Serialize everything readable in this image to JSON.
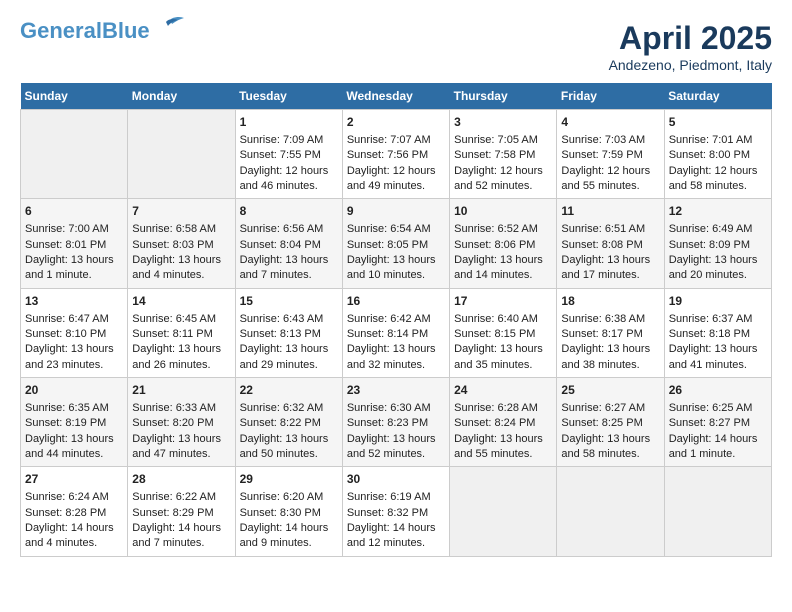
{
  "header": {
    "logo_general": "General",
    "logo_blue": "Blue",
    "month": "April 2025",
    "location": "Andezeno, Piedmont, Italy"
  },
  "weekdays": [
    "Sunday",
    "Monday",
    "Tuesday",
    "Wednesday",
    "Thursday",
    "Friday",
    "Saturday"
  ],
  "weeks": [
    [
      {
        "day": "",
        "empty": true
      },
      {
        "day": "",
        "empty": true
      },
      {
        "day": "1",
        "sunrise": "Sunrise: 7:09 AM",
        "sunset": "Sunset: 7:55 PM",
        "daylight": "Daylight: 12 hours and 46 minutes."
      },
      {
        "day": "2",
        "sunrise": "Sunrise: 7:07 AM",
        "sunset": "Sunset: 7:56 PM",
        "daylight": "Daylight: 12 hours and 49 minutes."
      },
      {
        "day": "3",
        "sunrise": "Sunrise: 7:05 AM",
        "sunset": "Sunset: 7:58 PM",
        "daylight": "Daylight: 12 hours and 52 minutes."
      },
      {
        "day": "4",
        "sunrise": "Sunrise: 7:03 AM",
        "sunset": "Sunset: 7:59 PM",
        "daylight": "Daylight: 12 hours and 55 minutes."
      },
      {
        "day": "5",
        "sunrise": "Sunrise: 7:01 AM",
        "sunset": "Sunset: 8:00 PM",
        "daylight": "Daylight: 12 hours and 58 minutes."
      }
    ],
    [
      {
        "day": "6",
        "sunrise": "Sunrise: 7:00 AM",
        "sunset": "Sunset: 8:01 PM",
        "daylight": "Daylight: 13 hours and 1 minute."
      },
      {
        "day": "7",
        "sunrise": "Sunrise: 6:58 AM",
        "sunset": "Sunset: 8:03 PM",
        "daylight": "Daylight: 13 hours and 4 minutes."
      },
      {
        "day": "8",
        "sunrise": "Sunrise: 6:56 AM",
        "sunset": "Sunset: 8:04 PM",
        "daylight": "Daylight: 13 hours and 7 minutes."
      },
      {
        "day": "9",
        "sunrise": "Sunrise: 6:54 AM",
        "sunset": "Sunset: 8:05 PM",
        "daylight": "Daylight: 13 hours and 10 minutes."
      },
      {
        "day": "10",
        "sunrise": "Sunrise: 6:52 AM",
        "sunset": "Sunset: 8:06 PM",
        "daylight": "Daylight: 13 hours and 14 minutes."
      },
      {
        "day": "11",
        "sunrise": "Sunrise: 6:51 AM",
        "sunset": "Sunset: 8:08 PM",
        "daylight": "Daylight: 13 hours and 17 minutes."
      },
      {
        "day": "12",
        "sunrise": "Sunrise: 6:49 AM",
        "sunset": "Sunset: 8:09 PM",
        "daylight": "Daylight: 13 hours and 20 minutes."
      }
    ],
    [
      {
        "day": "13",
        "sunrise": "Sunrise: 6:47 AM",
        "sunset": "Sunset: 8:10 PM",
        "daylight": "Daylight: 13 hours and 23 minutes."
      },
      {
        "day": "14",
        "sunrise": "Sunrise: 6:45 AM",
        "sunset": "Sunset: 8:11 PM",
        "daylight": "Daylight: 13 hours and 26 minutes."
      },
      {
        "day": "15",
        "sunrise": "Sunrise: 6:43 AM",
        "sunset": "Sunset: 8:13 PM",
        "daylight": "Daylight: 13 hours and 29 minutes."
      },
      {
        "day": "16",
        "sunrise": "Sunrise: 6:42 AM",
        "sunset": "Sunset: 8:14 PM",
        "daylight": "Daylight: 13 hours and 32 minutes."
      },
      {
        "day": "17",
        "sunrise": "Sunrise: 6:40 AM",
        "sunset": "Sunset: 8:15 PM",
        "daylight": "Daylight: 13 hours and 35 minutes."
      },
      {
        "day": "18",
        "sunrise": "Sunrise: 6:38 AM",
        "sunset": "Sunset: 8:17 PM",
        "daylight": "Daylight: 13 hours and 38 minutes."
      },
      {
        "day": "19",
        "sunrise": "Sunrise: 6:37 AM",
        "sunset": "Sunset: 8:18 PM",
        "daylight": "Daylight: 13 hours and 41 minutes."
      }
    ],
    [
      {
        "day": "20",
        "sunrise": "Sunrise: 6:35 AM",
        "sunset": "Sunset: 8:19 PM",
        "daylight": "Daylight: 13 hours and 44 minutes."
      },
      {
        "day": "21",
        "sunrise": "Sunrise: 6:33 AM",
        "sunset": "Sunset: 8:20 PM",
        "daylight": "Daylight: 13 hours and 47 minutes."
      },
      {
        "day": "22",
        "sunrise": "Sunrise: 6:32 AM",
        "sunset": "Sunset: 8:22 PM",
        "daylight": "Daylight: 13 hours and 50 minutes."
      },
      {
        "day": "23",
        "sunrise": "Sunrise: 6:30 AM",
        "sunset": "Sunset: 8:23 PM",
        "daylight": "Daylight: 13 hours and 52 minutes."
      },
      {
        "day": "24",
        "sunrise": "Sunrise: 6:28 AM",
        "sunset": "Sunset: 8:24 PM",
        "daylight": "Daylight: 13 hours and 55 minutes."
      },
      {
        "day": "25",
        "sunrise": "Sunrise: 6:27 AM",
        "sunset": "Sunset: 8:25 PM",
        "daylight": "Daylight: 13 hours and 58 minutes."
      },
      {
        "day": "26",
        "sunrise": "Sunrise: 6:25 AM",
        "sunset": "Sunset: 8:27 PM",
        "daylight": "Daylight: 14 hours and 1 minute."
      }
    ],
    [
      {
        "day": "27",
        "sunrise": "Sunrise: 6:24 AM",
        "sunset": "Sunset: 8:28 PM",
        "daylight": "Daylight: 14 hours and 4 minutes."
      },
      {
        "day": "28",
        "sunrise": "Sunrise: 6:22 AM",
        "sunset": "Sunset: 8:29 PM",
        "daylight": "Daylight: 14 hours and 7 minutes."
      },
      {
        "day": "29",
        "sunrise": "Sunrise: 6:20 AM",
        "sunset": "Sunset: 8:30 PM",
        "daylight": "Daylight: 14 hours and 9 minutes."
      },
      {
        "day": "30",
        "sunrise": "Sunrise: 6:19 AM",
        "sunset": "Sunset: 8:32 PM",
        "daylight": "Daylight: 14 hours and 12 minutes."
      },
      {
        "day": "",
        "empty": true
      },
      {
        "day": "",
        "empty": true
      },
      {
        "day": "",
        "empty": true
      }
    ]
  ]
}
